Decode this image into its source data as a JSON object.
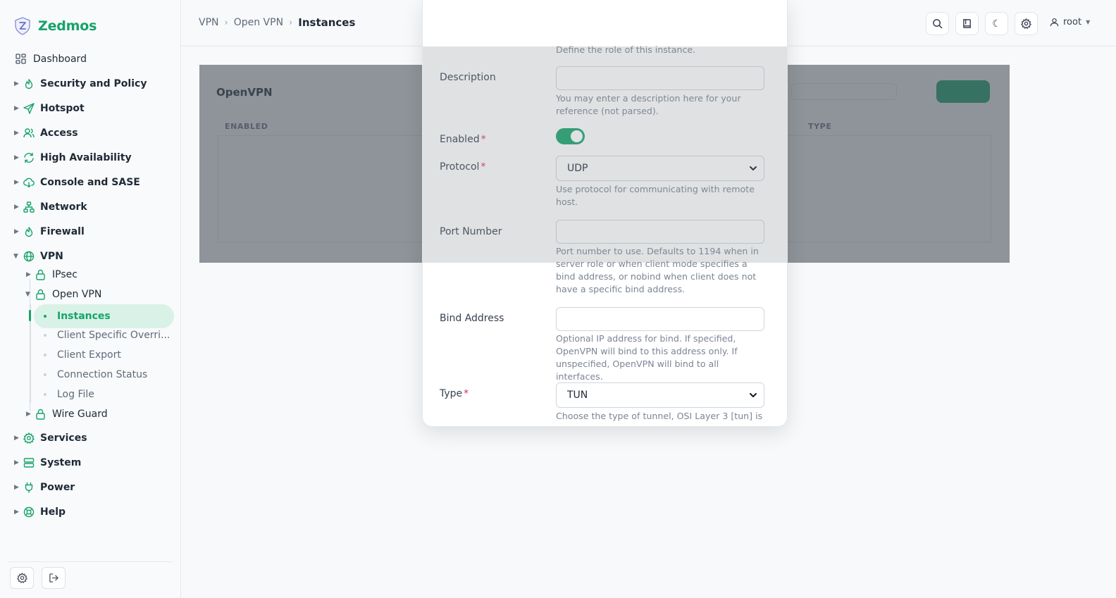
{
  "app": {
    "name": "Zedmos"
  },
  "breadcrumbs": [
    "VPN",
    "Open VPN",
    "Instances"
  ],
  "header": {
    "user": "root"
  },
  "sidebar": {
    "items": [
      {
        "label": "Dashboard",
        "icon": "dashboard-icon"
      },
      {
        "label": "Security and Policy",
        "icon": "flame-icon"
      },
      {
        "label": "Hotspot",
        "icon": "send-icon"
      },
      {
        "label": "Access",
        "icon": "users-icon"
      },
      {
        "label": "High Availability",
        "icon": "refresh-icon"
      },
      {
        "label": "Console and SASE",
        "icon": "cloud-icon"
      },
      {
        "label": "Network",
        "icon": "network-icon"
      },
      {
        "label": "Firewall",
        "icon": "flame-icon"
      },
      {
        "label": "VPN",
        "icon": "globe-icon"
      },
      {
        "label": "Services",
        "icon": "gear-icon"
      },
      {
        "label": "System",
        "icon": "server-icon"
      },
      {
        "label": "Power",
        "icon": "plug-icon"
      },
      {
        "label": "Help",
        "icon": "lifebuoy-icon"
      }
    ],
    "vpn_children": [
      {
        "label": "IPsec",
        "icon": "lock-icon"
      },
      {
        "label": "Open VPN",
        "icon": "lock-icon"
      },
      {
        "label": "Wire Guard",
        "icon": "lock-icon"
      }
    ],
    "openvpn_children": [
      {
        "label": "Instances"
      },
      {
        "label": "Client Specific Overri..."
      },
      {
        "label": "Client Export"
      },
      {
        "label": "Connection Status"
      },
      {
        "label": "Log File"
      }
    ]
  },
  "background_card": {
    "title": "OpenVPN",
    "columns": [
      "ENABLED",
      "TYPE"
    ]
  },
  "modal": {
    "role_help": "Define the role of this instance.",
    "description": {
      "label": "Description",
      "value": "",
      "help": "You may enter a description here for your reference (not parsed)."
    },
    "enabled": {
      "label": "Enabled",
      "required": "*",
      "on": true
    },
    "protocol": {
      "label": "Protocol",
      "required": "*",
      "value": "UDP",
      "help": "Use protocol for communicating with remote host."
    },
    "port": {
      "label": "Port Number",
      "value": "",
      "help": "Port number to use. Defaults to 1194 when in server role or when client mode specifies a bind address, or nobind when client does not have a specific bind address."
    },
    "bind": {
      "label": "Bind Address",
      "value": "",
      "help": "Optional IP address for bind. If specified, OpenVPN will bind to this address only. If unspecified, OpenVPN will bind to all interfaces."
    },
    "type": {
      "label": "Type",
      "required": "*",
      "value": "TUN",
      "help": "Choose the type of tunnel, OSI Layer 3 [tun] is"
    }
  },
  "colors": {
    "accent": "#16a36a",
    "required": "#db2777"
  }
}
